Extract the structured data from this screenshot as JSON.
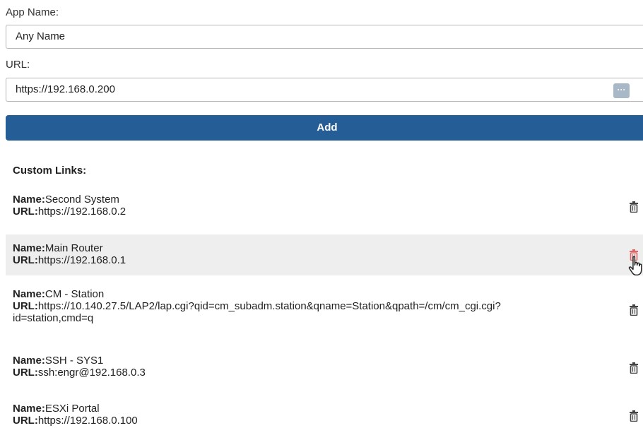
{
  "form": {
    "app_name_label": "App Name:",
    "app_name_value": "Any Name",
    "url_label": "URL:",
    "url_value": "https://192.168.0.200",
    "url_button_icon": "ellipsis-icon",
    "add_label": "Add"
  },
  "custom_links": {
    "title": "Custom Links:",
    "name_prefix": "Name:",
    "url_prefix": "URL:",
    "items": [
      {
        "name": "Second System",
        "url": "https://192.168.0.2"
      },
      {
        "name": "Main Router",
        "url": "https://192.168.0.1",
        "hovered": true
      },
      {
        "name": "CM - Station",
        "url": "https://10.140.27.5/LAP2/lap.cgi?qid=cm_subadm.station&qname=Station&qpath=/cm/cm_cgi.cgi?",
        "url_cont": "id=station,cmd=q"
      },
      {
        "name": "SSH - SYS1",
        "url": "ssh:engr@192.168.0.3"
      },
      {
        "name": "ESXi Portal",
        "url": "https://192.168.0.100"
      }
    ],
    "delete_icon": "trash-icon"
  },
  "colors": {
    "primary": "#255d96",
    "hover_row": "#eeeeee",
    "trash_default": "#444444",
    "trash_hover": "#e06666"
  }
}
